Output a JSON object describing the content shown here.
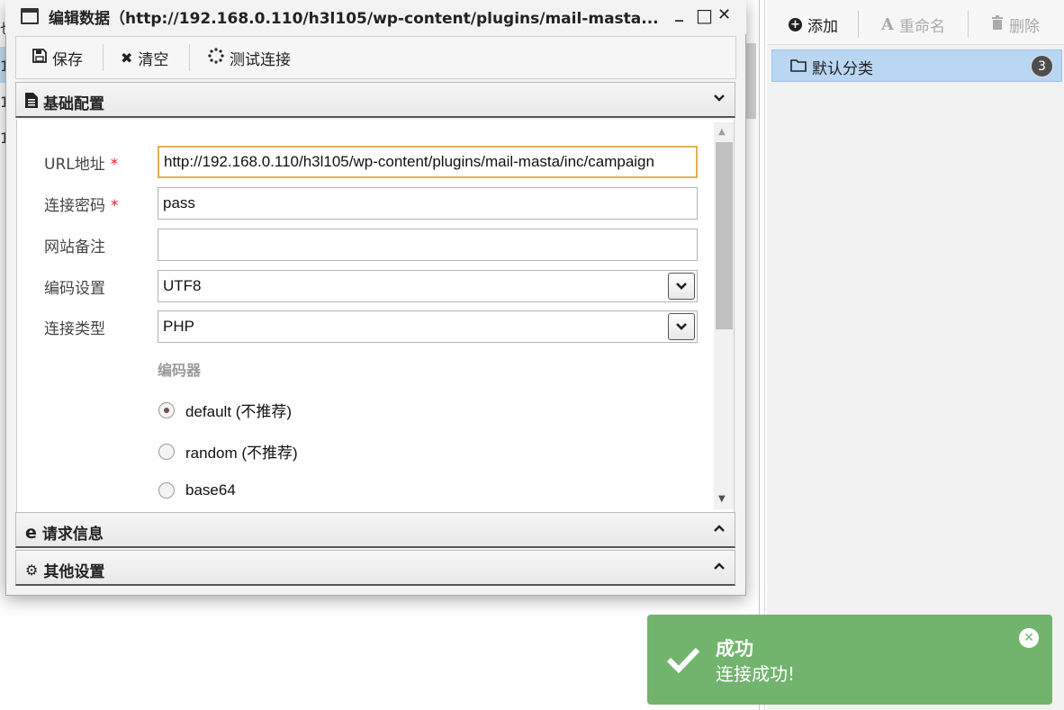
{
  "window": {
    "title": "编辑数据（http://192.168.0.110/h3l105/wp-content/plugins/mail-masta...",
    "min_glyph": "_",
    "max_glyph": "□",
    "close_glyph": "✕"
  },
  "toolbar": {
    "save_label": "保存",
    "clear_label": "清空",
    "test_label": "测试连接"
  },
  "sections": {
    "basic": "基础配置",
    "request": "请求信息",
    "other": "其他设置"
  },
  "form": {
    "url_label": "URL地址",
    "url_value": "http://192.168.0.110/h3l105/wp-content/plugins/mail-masta/inc/campaign",
    "password_label": "连接密码",
    "password_value": "pass",
    "note_label": "网站备注",
    "note_value": "",
    "encoding_label": "编码设置",
    "encoding_value": "UTF8",
    "type_label": "连接类型",
    "type_value": "PHP",
    "required_mark": "*",
    "encoder_title": "编码器",
    "encoders": [
      "default (不推荐)",
      "random (不推荐)",
      "base64"
    ],
    "encoder_selected": 0
  },
  "category_panel": {
    "add_label": "添加",
    "rename_label": "重命名",
    "delete_label": "删除",
    "item_label": "默认分类",
    "item_count": "3"
  },
  "background_rows": [
    "也",
    "1",
    "1",
    "1"
  ],
  "toast": {
    "title": "成功",
    "message": "连接成功!",
    "color": "#72b46e"
  }
}
